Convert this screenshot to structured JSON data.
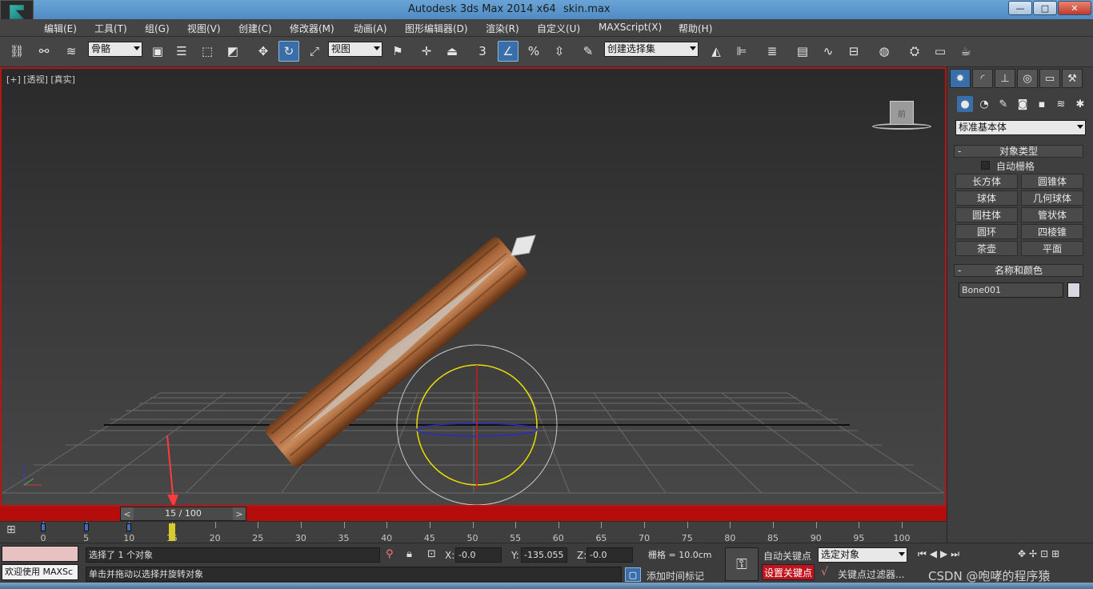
{
  "window": {
    "title": "Autodesk 3ds Max  2014 x64",
    "file": "skin.max",
    "minimize": "—",
    "maximize": "□",
    "close": "✕"
  },
  "menu": [
    "编辑(E)",
    "工具(T)",
    "组(G)",
    "视图(V)",
    "创建(C)",
    "修改器(M)",
    "动画(A)",
    "图形编辑器(D)",
    "渲染(R)",
    "自定义(U)",
    "MAXScript(X)",
    "帮助(H)"
  ],
  "toolbar": {
    "selection_filter": "骨骼",
    "reference_coord": "视图",
    "snap_label": "3",
    "percent_snap": "%",
    "named_selection": "创建选择集"
  },
  "viewport": {
    "label": "[+] [透视] [真实]",
    "viewcube_face": "前"
  },
  "timeline": {
    "prev": "<",
    "next": ">",
    "readout": "15 / 100",
    "current_frame": 15,
    "total_frames": 100,
    "tick_labels": [
      "0",
      "5",
      "10",
      "15",
      "20",
      "25",
      "30",
      "35",
      "40",
      "45",
      "50",
      "55",
      "60",
      "65",
      "70",
      "75",
      "80",
      "85",
      "90",
      "95",
      "100"
    ],
    "key_frames": [
      0,
      5,
      10,
      15
    ]
  },
  "status": {
    "maxscript_listener": "欢迎使用 MAXSc",
    "selection_info": "选择了 1 个对象",
    "prompt": "单击并拖动以选择并旋转对象",
    "x_label": "X:",
    "x_value": "-0.0",
    "y_label": "Y:",
    "y_value": "-135.055",
    "z_label": "Z:",
    "z_value": "-0.0",
    "grid": "栅格 = 10.0cm",
    "add_time_tag": "添加时间标记",
    "auto_key": "自动关键点",
    "set_key": "设置关键点",
    "key_mode": "选定对象",
    "key_filters": "关键点过滤器...",
    "watermark": "CSDN @咆哮的程序猿"
  },
  "command_panel": {
    "category": "标准基本体",
    "object_type_title": "对象类型",
    "autogrid": "自动栅格",
    "object_buttons": [
      "长方体",
      "圆锥体",
      "球体",
      "几何球体",
      "圆柱体",
      "管状体",
      "圆环",
      "四棱锥",
      "茶壶",
      "平面"
    ],
    "name_color_title": "名称和颜色",
    "object_name": "Bone001",
    "rollout_minus": "-"
  },
  "colors": {
    "viewport_border": "#b81414",
    "timebar": "#b50c0c",
    "active_blue": "#3a6ea8",
    "rotate_gizmo_yellow": "#e8e000"
  }
}
